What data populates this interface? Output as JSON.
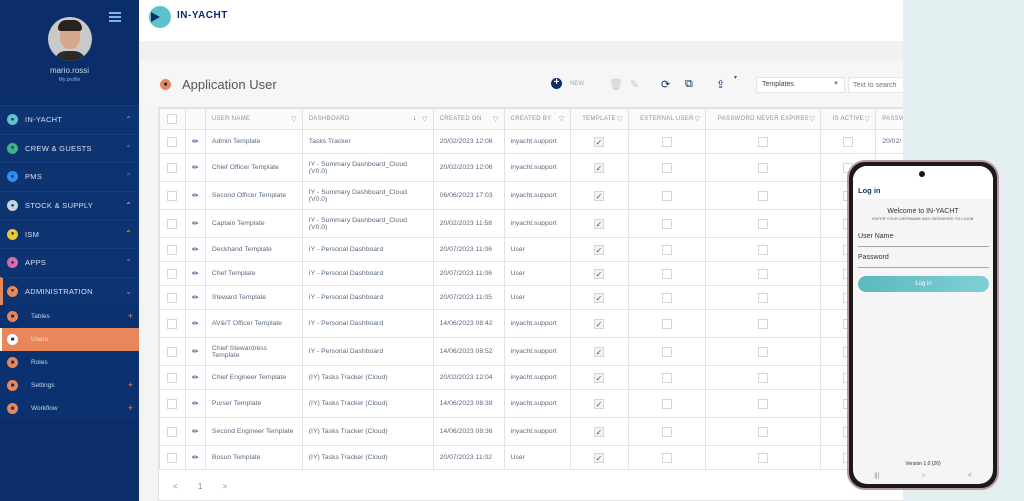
{
  "sidebar": {
    "username": "mario.rossi",
    "profile_link": "My profile",
    "sections": [
      {
        "label": "IN-YACHT",
        "icon": "ship-icon",
        "color": "#5ec1cc",
        "chevron": "^"
      },
      {
        "label": "CREW & GUESTS",
        "icon": "crew-icon",
        "color": "#3fb37f",
        "chevron": "^"
      },
      {
        "label": "PMS",
        "icon": "tools-icon",
        "color": "#2d8ff0",
        "chevron": "^"
      },
      {
        "label": "STOCK & SUPPLY",
        "icon": "box-icon",
        "color": "#c9d1dc",
        "chevron": "^"
      },
      {
        "label": "ISM",
        "icon": "ism-icon",
        "color": "#f0c330",
        "chevron": "^"
      },
      {
        "label": "APPS",
        "icon": "apps-icon",
        "color": "#d96aa8",
        "chevron": "^"
      },
      {
        "label": "ADMINISTRATION",
        "icon": "key-icon",
        "color": "#e8875a",
        "chevron": "v"
      }
    ],
    "admin_items": [
      {
        "label": "Tables",
        "icon": "list-icon",
        "expandable": true
      },
      {
        "label": "Users",
        "icon": "lock-icon",
        "active": true
      },
      {
        "label": "Roles",
        "icon": "shield-icon"
      },
      {
        "label": "Settings",
        "icon": "settings-icon",
        "expandable": true
      },
      {
        "label": "Workflow",
        "icon": "workflow-icon",
        "expandable": true
      }
    ]
  },
  "header": {
    "brand": "IN-YACHT"
  },
  "page": {
    "title": "Application User",
    "toolbar": {
      "new_label": "NEW"
    },
    "filter_select": "Templates",
    "search_placeholder": "Text to search"
  },
  "table": {
    "columns": [
      "USER NAME",
      "DASHBOARD",
      "CREATED ON",
      "CREATED BY",
      "TEMPLATE",
      "EXTERNAL USER",
      "PASSWORD NEVER EXPIRES",
      "IS ACTIVE",
      "PASSWO"
    ],
    "rows": [
      {
        "user": "Admin Template",
        "dashboard": "Tasks Tracker",
        "created_on": "20/02/2023 12:08",
        "created_by": "inyacht.support",
        "template": true,
        "external": false,
        "pne": false,
        "active": false,
        "pw": "20/02/"
      },
      {
        "user": "Chief Officer Template",
        "dashboard": "IY - Summary Dashboard_Cloud (V0.0)",
        "created_on": "20/02/2023 12:06",
        "created_by": "inyacht.support",
        "template": true,
        "external": false,
        "pne": false,
        "active": false,
        "pw": ""
      },
      {
        "user": "Second Officer Template",
        "dashboard": "IY - Summary Dashboard_Cloud (V0.0)",
        "created_on": "06/06/2023 17:03",
        "created_by": "inyacht.support",
        "template": true,
        "external": false,
        "pne": false,
        "active": false,
        "pw": ""
      },
      {
        "user": "Captain Template",
        "dashboard": "IY - Summary Dashboard_Cloud (V0.0)",
        "created_on": "20/02/2023 11:58",
        "created_by": "inyacht.support",
        "template": true,
        "external": false,
        "pne": false,
        "active": false,
        "pw": ""
      },
      {
        "user": "Deckhand Template",
        "dashboard": "IY - Personal Dashboard",
        "created_on": "20/07/2023 11:06",
        "created_by": "User",
        "template": true,
        "external": false,
        "pne": false,
        "active": false,
        "pw": ""
      },
      {
        "user": "Chef Template",
        "dashboard": "IY - Personal Dashboard",
        "created_on": "20/07/2023 11:06",
        "created_by": "User",
        "template": true,
        "external": false,
        "pne": false,
        "active": false,
        "pw": ""
      },
      {
        "user": "Steward Template",
        "dashboard": "IY - Personal Dashboard",
        "created_on": "20/07/2023 11:05",
        "created_by": "User",
        "template": true,
        "external": false,
        "pne": false,
        "active": false,
        "pw": ""
      },
      {
        "user": "AV&IT Officer Template",
        "dashboard": "IY - Personal Dashboard",
        "created_on": "14/06/2023 08:42",
        "created_by": "inyacht.support",
        "template": true,
        "external": false,
        "pne": false,
        "active": false,
        "pw": ""
      },
      {
        "user": "Chief Steward/ess Template",
        "dashboard": "IY - Personal Dashboard",
        "created_on": "14/06/2023 08:52",
        "created_by": "inyacht.support",
        "template": true,
        "external": false,
        "pne": false,
        "active": false,
        "pw": ""
      },
      {
        "user": "Chief Engineer Template",
        "dashboard": "(IY) Tasks Tracker (Cloud)",
        "created_on": "20/02/2023 12:04",
        "created_by": "inyacht.support",
        "template": true,
        "external": false,
        "pne": false,
        "active": false,
        "pw": ""
      },
      {
        "user": "Purser Template",
        "dashboard": "(IY) Tasks Tracker (Cloud)",
        "created_on": "14/06/2023 08:39",
        "created_by": "inyacht.support",
        "template": true,
        "external": false,
        "pne": false,
        "active": false,
        "pw": ""
      },
      {
        "user": "Second Engineer Template",
        "dashboard": "(IY) Tasks Tracker (Cloud)",
        "created_on": "14/06/2023 08:36",
        "created_by": "inyacht.support",
        "template": true,
        "external": false,
        "pne": false,
        "active": false,
        "pw": ""
      },
      {
        "user": "Bosun Template",
        "dashboard": "(IY) Tasks Tracker (Cloud)",
        "created_on": "20/07/2023 11:02",
        "created_by": "User",
        "template": true,
        "external": false,
        "pne": false,
        "active": false,
        "pw": ""
      }
    ],
    "pagination": {
      "prev": "<",
      "page": "1",
      "next": ">"
    }
  },
  "phone": {
    "title": "Log in",
    "welcome": "Welcome to IN-YACHT",
    "instruction": "ENTER YOUR USERNAME AND PASSWORD TO LOGIN",
    "username_placeholder": "User Name",
    "password_placeholder": "Password",
    "login_button": "Log in",
    "version": "Version 1.0 (26)",
    "nav": [
      "|||",
      "○",
      "<"
    ]
  }
}
